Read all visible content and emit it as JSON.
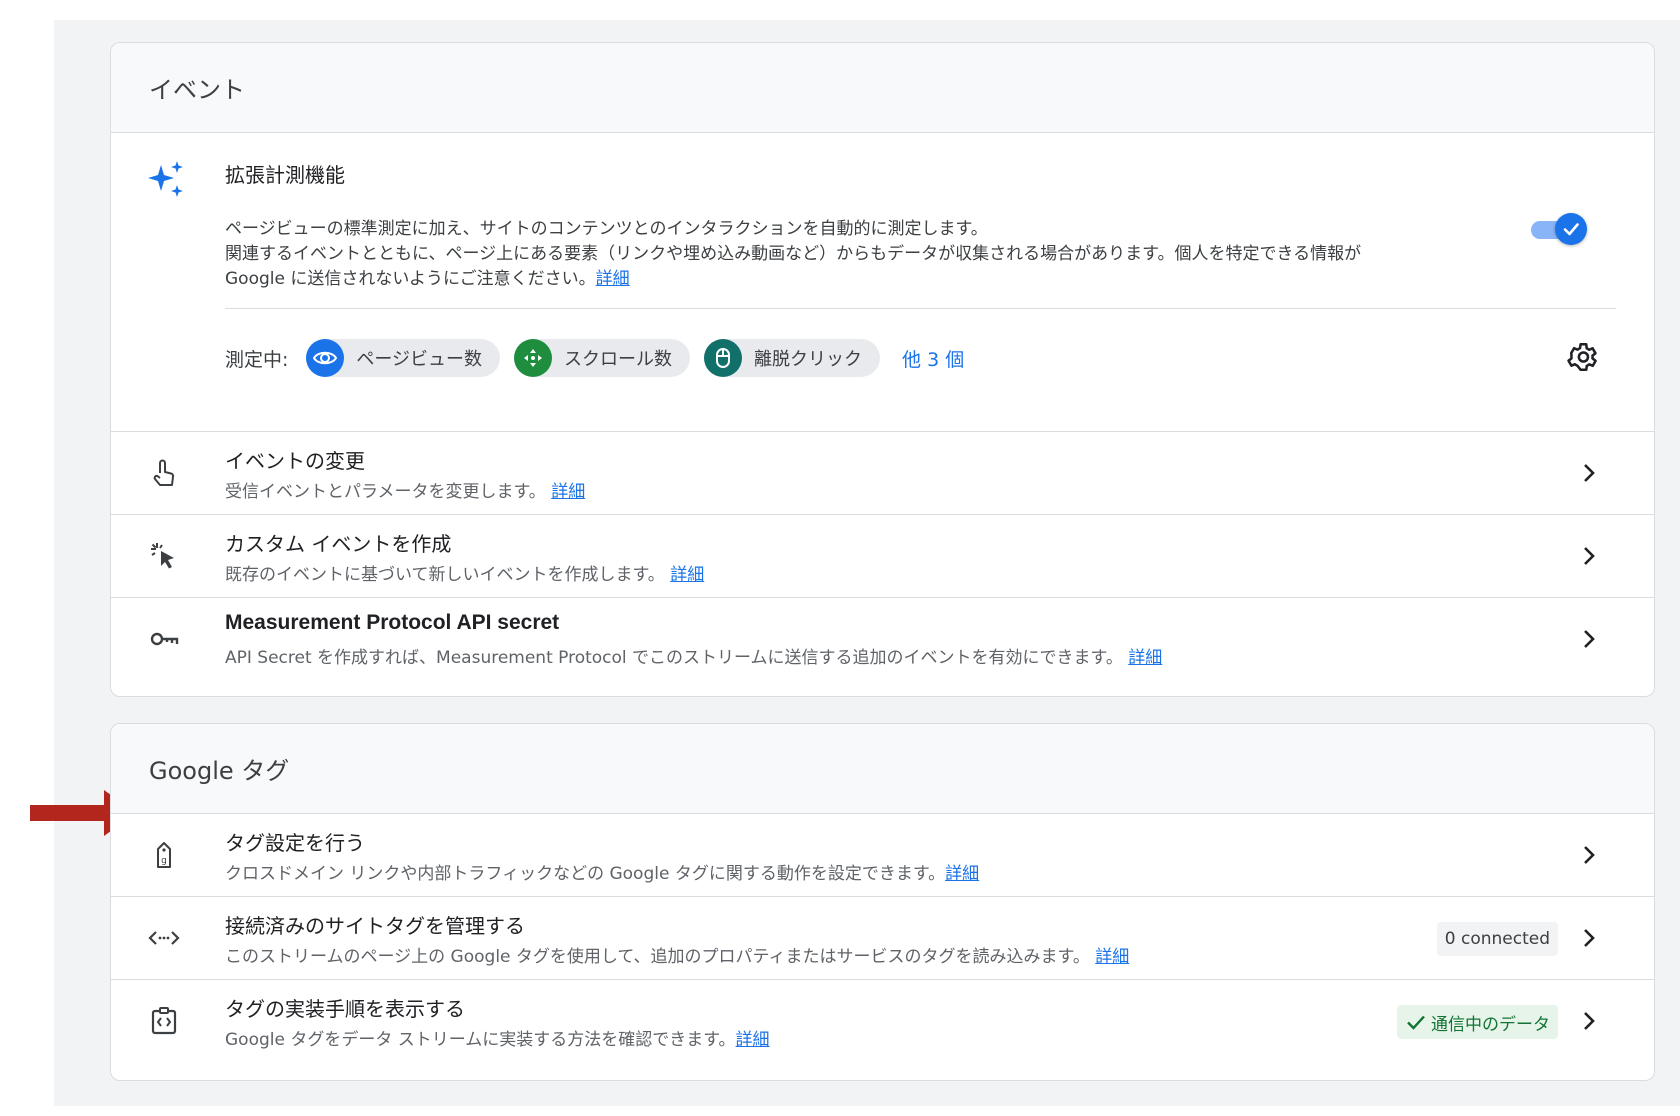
{
  "events_card": {
    "header": "イベント",
    "enhanced": {
      "title": "拡張計測機能",
      "desc_line1": "ページビューの標準測定に加え、サイトのコンテンツとのインタラクションを自動的に測定します。",
      "desc_line2": "関連するイベントとともに、ページ上にある要素（リンクや埋め込み動画など）からもデータが収集される場合があります。個人を特定できる情報が",
      "desc_line3": "Google に送信されないようにご注意ください。",
      "desc_link": "詳細",
      "toggle_on": true,
      "measuring_label": "測定中:",
      "chips": [
        {
          "label": "ページビュー数",
          "icon": "eye-icon",
          "color": "#1a73e8"
        },
        {
          "label": "スクロール数",
          "icon": "scroll-arrows-icon",
          "color": "#1e8e3e"
        },
        {
          "label": "離脱クリック",
          "icon": "mouse-icon",
          "color": "#12706b"
        }
      ],
      "more": "他 3 個"
    },
    "rows": [
      {
        "title": "イベントの変更",
        "sub": "受信イベントとパラメータを変更します。",
        "link": "詳細",
        "icon": "touch-icon"
      },
      {
        "title": "カスタム イベントを作成",
        "sub": "既存のイベントに基づいて新しいイベントを作成します。",
        "link": "詳細",
        "icon": "click-icon"
      },
      {
        "title": "Measurement Protocol API secret",
        "sub": "API Secret を作成すれば、Measurement Protocol でこのストリームに送信する追加のイベントを有効にできます。",
        "link": "詳細",
        "icon": "key-icon"
      }
    ]
  },
  "google_card": {
    "header": "Google タグ",
    "rows": [
      {
        "title": "タグ設定を行う",
        "sub": "クロスドメイン リンクや内部トラフィックなどの Google タグに関する動作を設定できます。",
        "link": "詳細",
        "icon": "google-tag-icon"
      },
      {
        "title": "接続済みのサイトタグを管理する",
        "sub": "このストリームのページ上の Google タグを使用して、追加のプロパティまたはサービスのタグを読み込みます。",
        "link": "詳細",
        "icon": "code-icon",
        "badge": "0 connected"
      },
      {
        "title": "タグの実装手順を表示する",
        "sub": "Google タグをデータ ストリームに実装する方法を確認できます。",
        "link": "詳細",
        "icon": "code-clipboard-icon",
        "badge": "通信中のデータ"
      }
    ]
  },
  "colors": {
    "accent": "#1a73e8",
    "annotation_arrow": "#b3261e"
  }
}
